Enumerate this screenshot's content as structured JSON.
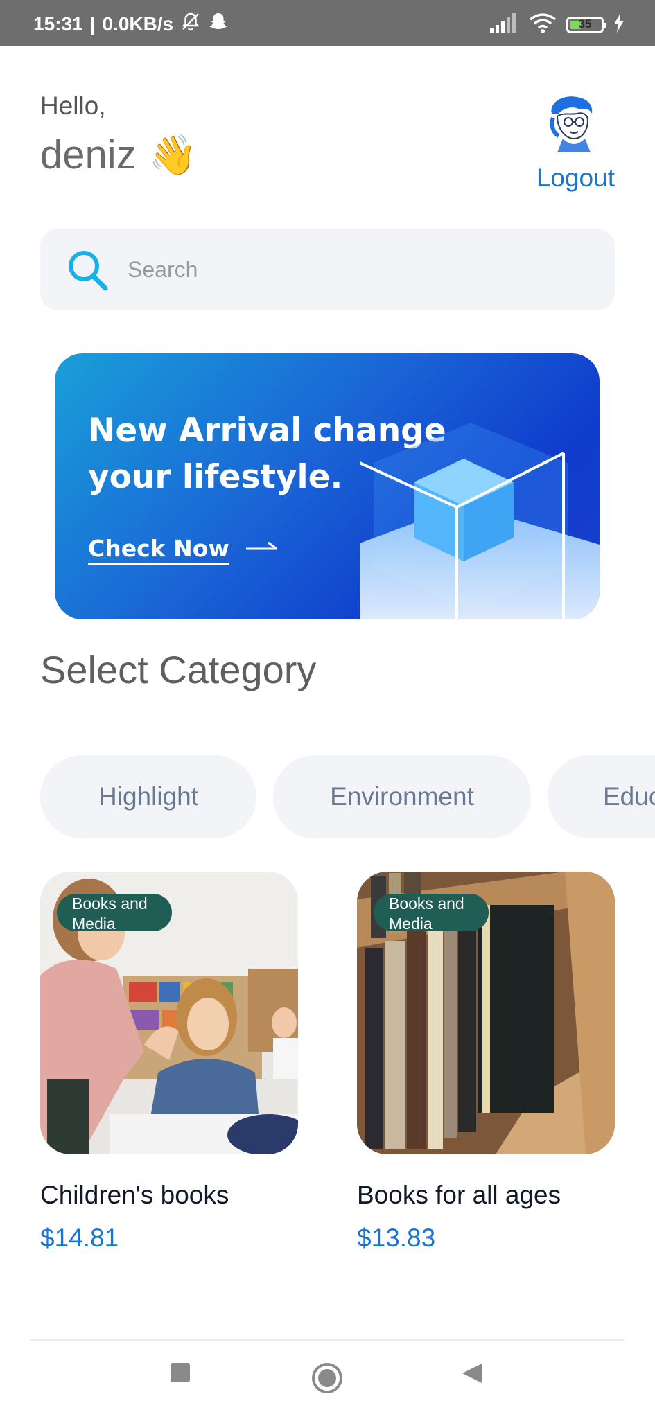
{
  "status_bar": {
    "time": "15:31",
    "speed": "0.0KB/s",
    "battery": "35",
    "battery_level": 0.35,
    "icons": [
      "bell-muted-icon",
      "snapchat-icon",
      "signal-icon",
      "wifi-icon",
      "battery-icon",
      "charging-icon"
    ]
  },
  "header": {
    "greeting": "Hello,",
    "username": "deniz",
    "wave_emoji": "👋",
    "logout_label": "Logout"
  },
  "search": {
    "placeholder": "Search"
  },
  "banner": {
    "title": "New Arrival change your lifestyle.",
    "cta_label": "Check Now",
    "cta_arrow": "→"
  },
  "categories": {
    "title": "Select Category",
    "items": [
      "Highlight",
      "Environment",
      "Educ"
    ]
  },
  "products": [
    {
      "badge": "Books and Media",
      "title": "Children's books",
      "price": "$14.81"
    },
    {
      "badge": "Books and Media",
      "title": "Books for all ages",
      "price": "$13.83"
    }
  ],
  "colors": {
    "accent": "#1b75d0",
    "badge": "#1f5d55",
    "status_bar": "#6e6e6e",
    "chip_bg": "#f3f4f8"
  }
}
